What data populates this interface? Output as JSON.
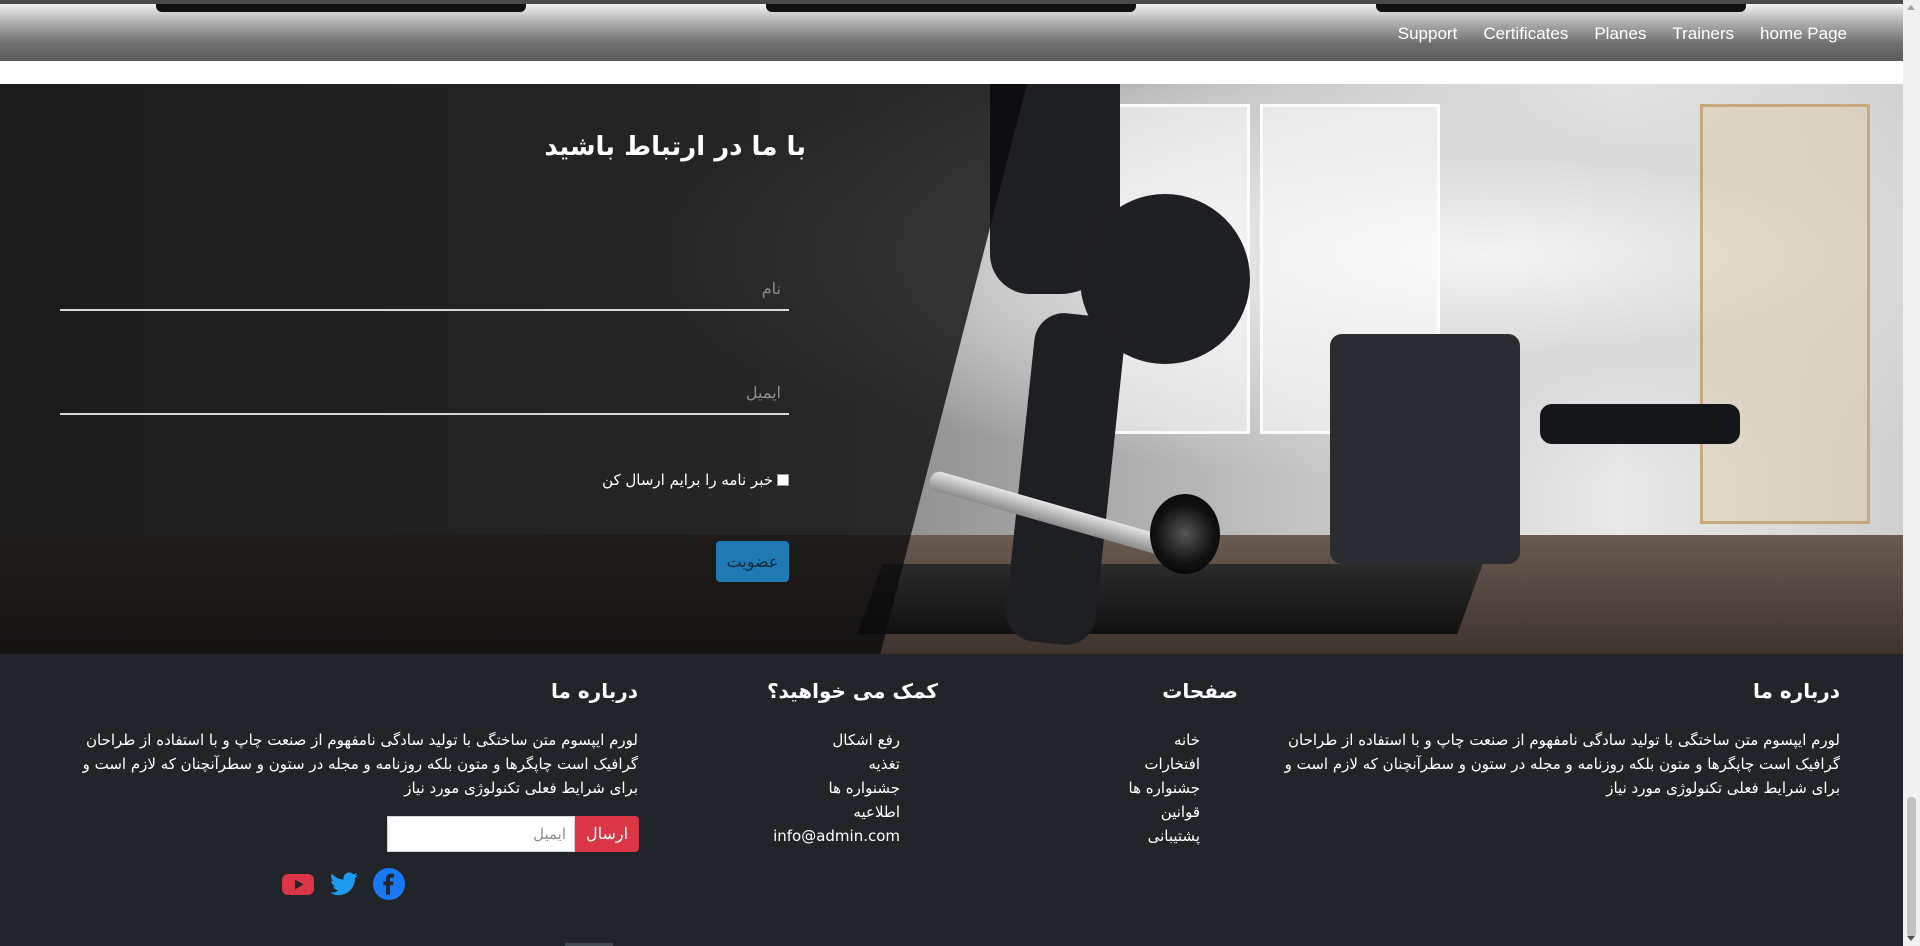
{
  "nav": {
    "links": [
      "home Page",
      "Trainers",
      "Planes",
      "Certificates",
      "Support"
    ]
  },
  "contact": {
    "title": "با ما در ارتباط باشید",
    "name_placeholder": "نام",
    "email_placeholder": "ایمیل",
    "newsletter_label": "خبر نامه را برایم ارسال کن",
    "submit_label": "عضویت",
    "submit_color": "#1f7ab3"
  },
  "footer": {
    "about_right": {
      "heading": "درباره ما",
      "text": "لورم ایپسوم متن ساختگی با تولید سادگی نامفهوم از صنعت چاپ و با استفاده از طراحان گرافیک است چاپگرها و متون بلکه روزنامه و مجله در ستون و سطرآنچنان که لازم است و برای شرایط فعلی تکنولوژی مورد نیاز"
    },
    "pages": {
      "heading": "صفحات",
      "items": [
        "خانه",
        "افتخارات",
        "جشنواره ها",
        "قوانین",
        "پشتیبانی"
      ]
    },
    "help": {
      "heading": "کمک می خواهید؟",
      "items": [
        "رفع اشکال",
        "تغذیه",
        "جشنواره ها",
        "اطلاعیه",
        "info@admin.com"
      ]
    },
    "about_left": {
      "heading": "درباره ما",
      "text": "لورم ایپسوم متن ساختگی با تولید سادگی نامفهوم از صنعت چاپ و با استفاده از طراحان گرافیک است چاپگرها و متون بلکه روزنامه و مجله در ستون و سطرآنچنان که لازم است و برای شرایط فعلی تکنولوژی مورد نیاز",
      "email_placeholder": "ایمیل",
      "send_label": "ارسال",
      "send_color": "#dc3545"
    },
    "social": [
      "facebook-icon",
      "twitter-icon",
      "youtube-icon"
    ],
    "background": "#212529"
  }
}
